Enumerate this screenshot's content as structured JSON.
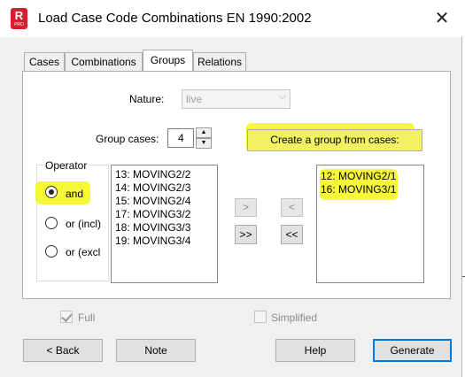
{
  "window": {
    "title": "Load Case Code Combinations EN 1990:2002",
    "icon_letter": "R",
    "icon_sub": "PRO",
    "close_glyph": "✕"
  },
  "tabs": [
    {
      "label": "Cases",
      "active": false
    },
    {
      "label": "Combinations",
      "active": false
    },
    {
      "label": "Groups",
      "active": true
    },
    {
      "label": "Relations",
      "active": false
    }
  ],
  "nature": {
    "label": "Nature:",
    "value": "live",
    "enabled": false
  },
  "group_cases": {
    "label": "Group cases:",
    "value": "4"
  },
  "create_group_button": "Create a group from cases:",
  "operator": {
    "title": "Operator",
    "options": [
      {
        "label": "and",
        "selected": true
      },
      {
        "label": "or (incl)",
        "selected": false
      },
      {
        "label": "or (excl",
        "selected": false
      }
    ]
  },
  "available_list": [
    "13: MOVING2/2",
    "14: MOVING2/3",
    "15: MOVING2/4",
    "17: MOVING3/2",
    "18: MOVING3/3",
    "19: MOVING3/4"
  ],
  "selected_list": [
    "12: MOVING2/1",
    "16: MOVING3/1"
  ],
  "transfer": {
    "add": ">",
    "add_all": ">>",
    "remove": "<",
    "remove_all": "<<"
  },
  "checks": {
    "full": {
      "label": "Full",
      "checked": true
    },
    "simplified": {
      "label": "Simplified",
      "checked": false
    }
  },
  "footer": {
    "back": "< Back",
    "note": "Note",
    "help": "Help",
    "generate": "Generate"
  },
  "colors": {
    "highlight": "#f7f73a",
    "icon_red": "#d6202d",
    "default_border": "#0078d7"
  }
}
